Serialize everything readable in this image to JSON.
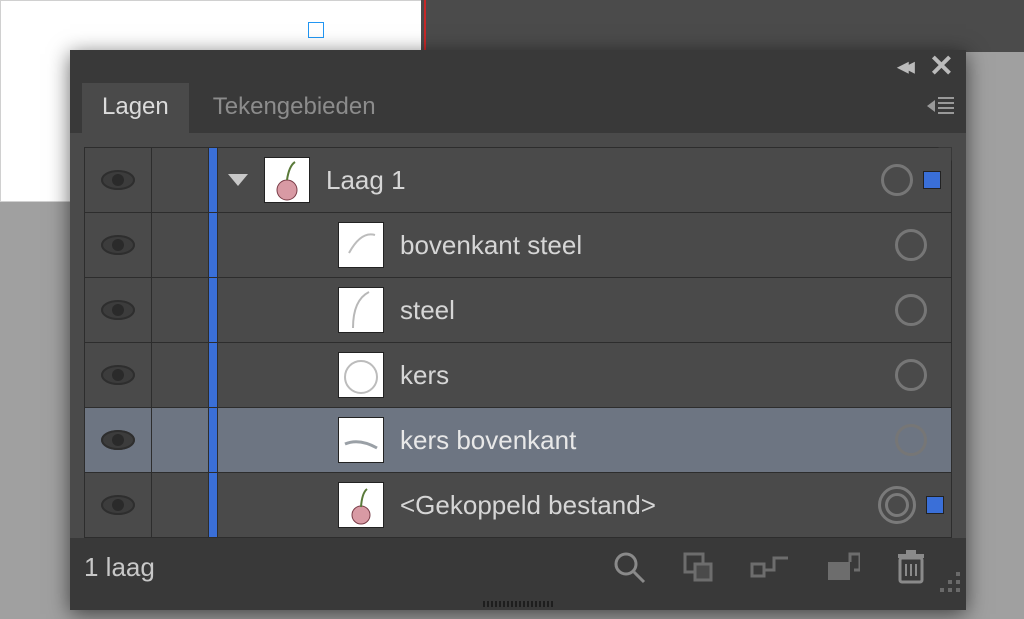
{
  "tabs": {
    "lagen": "Lagen",
    "tekengebieden": "Tekengebieden"
  },
  "layers": {
    "root": {
      "name": "Laag 1"
    },
    "items": [
      {
        "name": "bovenkant steel"
      },
      {
        "name": "steel"
      },
      {
        "name": "kers"
      },
      {
        "name": "kers bovenkant"
      },
      {
        "name": "<Gekoppeld bestand>"
      }
    ]
  },
  "footer": {
    "count_label": "1 laag"
  }
}
